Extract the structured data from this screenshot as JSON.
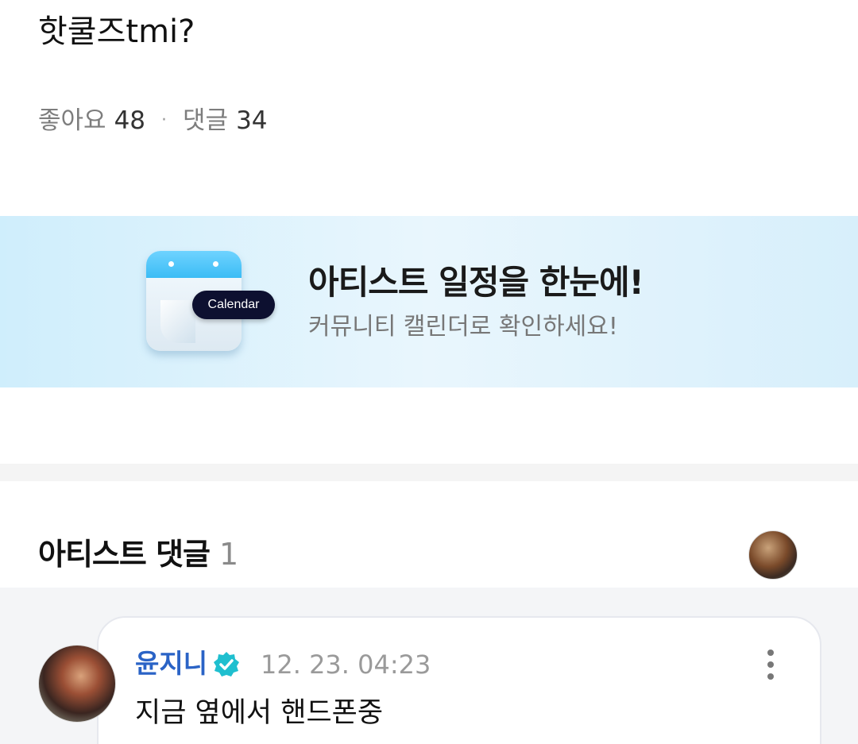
{
  "post": {
    "title": "핫쿨즈tmi?",
    "likes_label": "좋아요",
    "likes_count": "48",
    "separator": "·",
    "comments_label": "댓글",
    "comments_count": "34"
  },
  "banner": {
    "calendar_badge": "Calendar",
    "title": "아티스트 일정을 한눈에!",
    "subtitle": "커뮤니티 캘린더로 확인하세요!",
    "colors": {
      "background_start": "#cfeefc",
      "icon_accent": "#3bbcf5",
      "badge": "#0d1030"
    },
    "icon": "calendar-icon"
  },
  "artist_comments": {
    "title": "아티스트 댓글",
    "count": "1",
    "header_avatar_icon": "artist-avatar",
    "comments": [
      {
        "author": "윤지니",
        "verified_icon": "verified-badge-icon",
        "time": "12. 23. 04:23",
        "text": "지금 옆에서 핸드폰중",
        "more_icon": "more-vertical-icon"
      }
    ],
    "colors": {
      "author": "#2a63c6",
      "verified": "#1fbfcf"
    }
  }
}
